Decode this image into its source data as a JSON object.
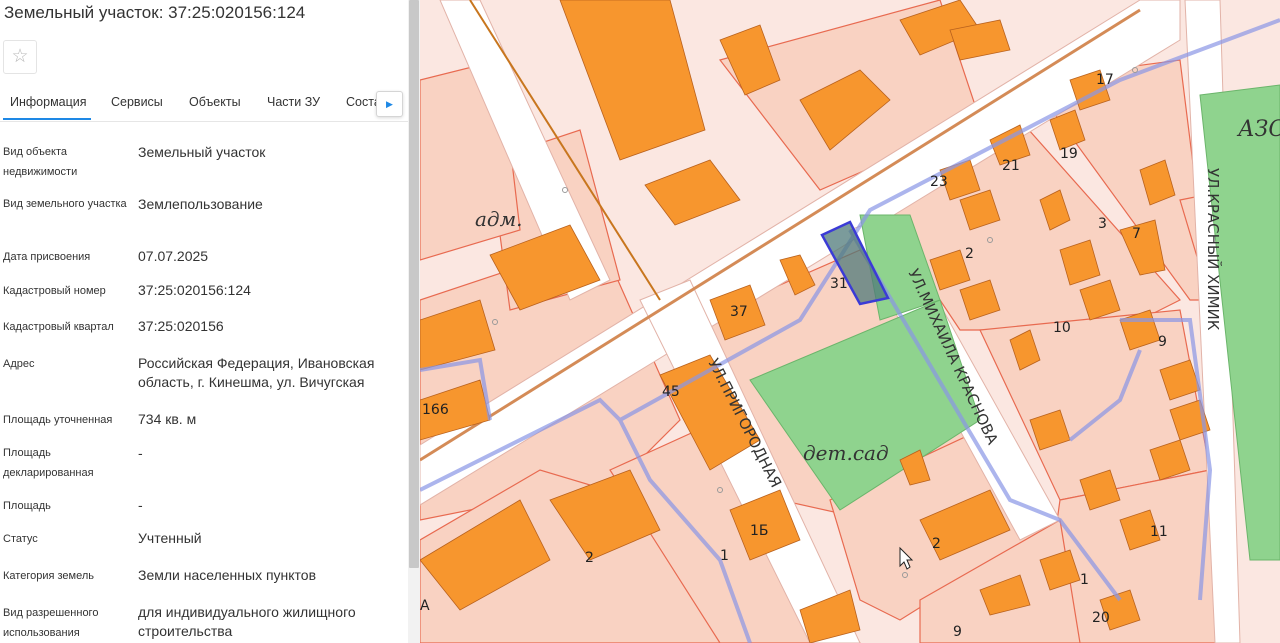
{
  "header": {
    "title": "Земельный участок: 37:25:020156:124",
    "favorite_glyph": "☆"
  },
  "tabs": [
    {
      "label": "Информация"
    },
    {
      "label": "Сервисы"
    },
    {
      "label": "Объекты"
    },
    {
      "label": "Части ЗУ"
    },
    {
      "label": "Состав"
    }
  ],
  "tab_next_glyph": "▶",
  "fields": [
    {
      "label": "Вид объекта недвижимости",
      "value": "Земельный участок"
    },
    {
      "label": "Вид земельного участка",
      "value": "Землепользование"
    },
    {
      "label": "Дата присвоения",
      "value": "07.07.2025"
    },
    {
      "label": "Кадастровый номер",
      "value": "37:25:020156:124"
    },
    {
      "label": "Кадастровый квартал",
      "value": "37:25:020156"
    },
    {
      "label": "Адрес",
      "value": "Российская Федерация, Ивановская область, г. Кинешма, ул. Вичугская"
    },
    {
      "label": "Площадь уточненная",
      "value": "734 кв. м"
    },
    {
      "label": "Площадь декларированная",
      "value": "-"
    },
    {
      "label": "Площадь",
      "value": "-"
    },
    {
      "label": "Статус",
      "value": "Учтенный"
    },
    {
      "label": "Категория земель",
      "value": "Земли населенных пунктов"
    },
    {
      "label": "Вид разрешенного использования",
      "value": "для индивидуального жилищного строительства"
    }
  ],
  "map": {
    "labels": {
      "adm": "адм.",
      "detsad": "дет.сад",
      "street_prigorodnaya": "УЛ.ПРИГОРОДНАЯ",
      "street_krasnova": "УЛ.МИХАИЛА КРАСНОВА",
      "street_khimik": "УЛ.КРАСНЫЙ ХИМИК",
      "azo": "АЗО",
      "n37": "37",
      "n31": "31",
      "n45": "45",
      "n166": "166",
      "n2a": "2",
      "n1b": "1Б",
      "n1": "1",
      "n2b": "2",
      "n2c": "2",
      "n23": "23",
      "n21": "21",
      "n19": "19",
      "n17": "17",
      "n3": "3",
      "n7": "7",
      "n10": "10",
      "n9a": "9",
      "n11": "11",
      "n9b": "9",
      "n20": "20",
      "n1c": "1",
      "a": "А"
    },
    "colors": {
      "background": "#fbe7e1",
      "parcel": "#f9d2c2",
      "parcel_border": "#e86a50",
      "building": "#f7962e",
      "green": "#8fd38e",
      "road": "#ffffff",
      "network": "#8a96e6",
      "selected_fill": "#4f7a7a",
      "selected_border": "#3b3bd6"
    }
  }
}
